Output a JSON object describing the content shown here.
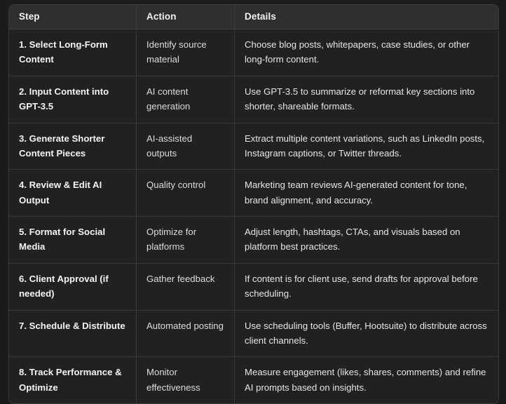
{
  "table": {
    "columns": [
      "Step",
      "Action",
      "Details"
    ],
    "rows": [
      {
        "step": "1. Select Long-Form Content",
        "action": "Identify source material",
        "details": "Choose blog posts, whitepapers, case studies, or other long-form content."
      },
      {
        "step": "2. Input Content into GPT-3.5",
        "action": "AI content generation",
        "details": "Use GPT-3.5 to summarize or reformat key sections into shorter, shareable formats."
      },
      {
        "step": "3. Generate Shorter Content Pieces",
        "action": "AI-assisted outputs",
        "details": "Extract multiple content variations, such as LinkedIn posts, Instagram captions, or Twitter threads."
      },
      {
        "step": "4. Review & Edit AI Output",
        "action": "Quality control",
        "details": "Marketing team reviews AI-generated content for tone, brand alignment, and accuracy."
      },
      {
        "step": "5. Format for Social Media",
        "action": "Optimize for platforms",
        "details": "Adjust length, hashtags, CTAs, and visuals based on platform best practices."
      },
      {
        "step": "6. Client Approval (if needed)",
        "action": "Gather feedback",
        "details": "If content is for client use, send drafts for approval before scheduling."
      },
      {
        "step": "7. Schedule & Distribute",
        "action": "Automated posting",
        "details": "Use scheduling tools (Buffer, Hootsuite) to distribute across client channels."
      },
      {
        "step": "8. Track Performance & Optimize",
        "action": "Monitor effectiveness",
        "details": "Measure engagement (likes, shares, comments) and refine AI prompts based on insights."
      }
    ]
  },
  "colors": {
    "page_background": "#1b1b1b",
    "table_background": "#212121",
    "header_background": "#2f2f2f",
    "border": "#383838",
    "text_primary": "#f4f4f4",
    "text_secondary": "#dcdcdc"
  }
}
